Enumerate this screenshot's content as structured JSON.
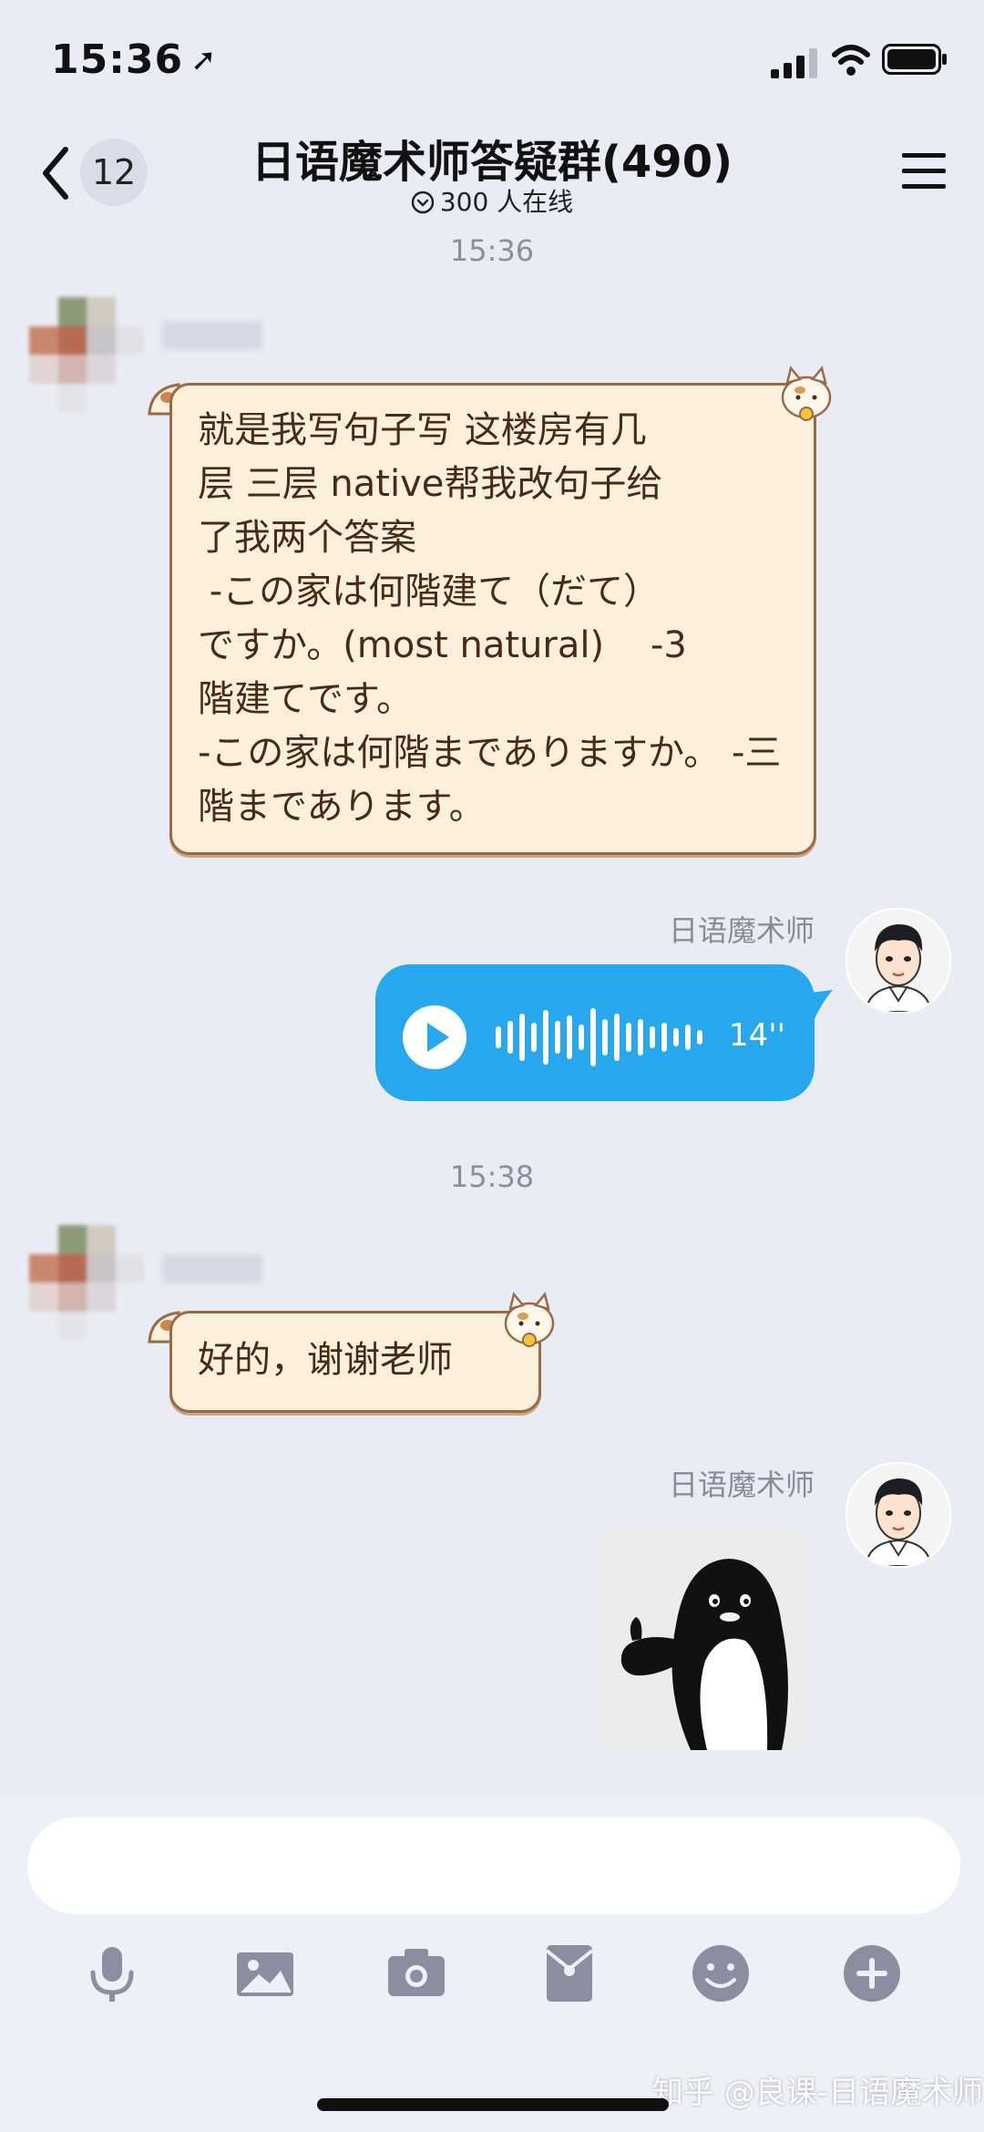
{
  "status_bar": {
    "time": "15:36"
  },
  "nav": {
    "unread_count": "12",
    "title": "日语魔术师答疑群(490)",
    "online": "300 人在线"
  },
  "messages": {
    "timestamp_1": "15:36",
    "msg1_text": "就是我写句子写 这楼房有几\n层 三层 native帮我改句子给\n了我两个答案\n -この家は何階建て（だて）\nですか。(most natural)    -3\n階建てです。\n-この家は何階までありますか。 -三階まであります。",
    "teacher_name_1": "日语魔术师",
    "voice_duration": "14''",
    "timestamp_2": "15:38",
    "msg2_text": "好的，谢谢老师",
    "teacher_name_2": "日语魔术师"
  },
  "watermark": "知乎 @良课-日语魔术师",
  "colors": {
    "background": "#e9ecf5",
    "voice_bubble": "#27a8ee",
    "cute_bubble_fill": "#fdf1dd",
    "cute_bubble_border": "#9a6a45",
    "toolbar_icon": "#8a8ea0"
  },
  "icons": [
    "location-arrow-icon",
    "signal-icon",
    "wifi-icon",
    "battery-icon",
    "back-chevron-icon",
    "online-status-icon",
    "menu-icon",
    "play-icon",
    "waveform-icon",
    "microphone-icon",
    "image-icon",
    "camera-icon",
    "red-packet-icon",
    "emoji-icon",
    "plus-icon"
  ]
}
